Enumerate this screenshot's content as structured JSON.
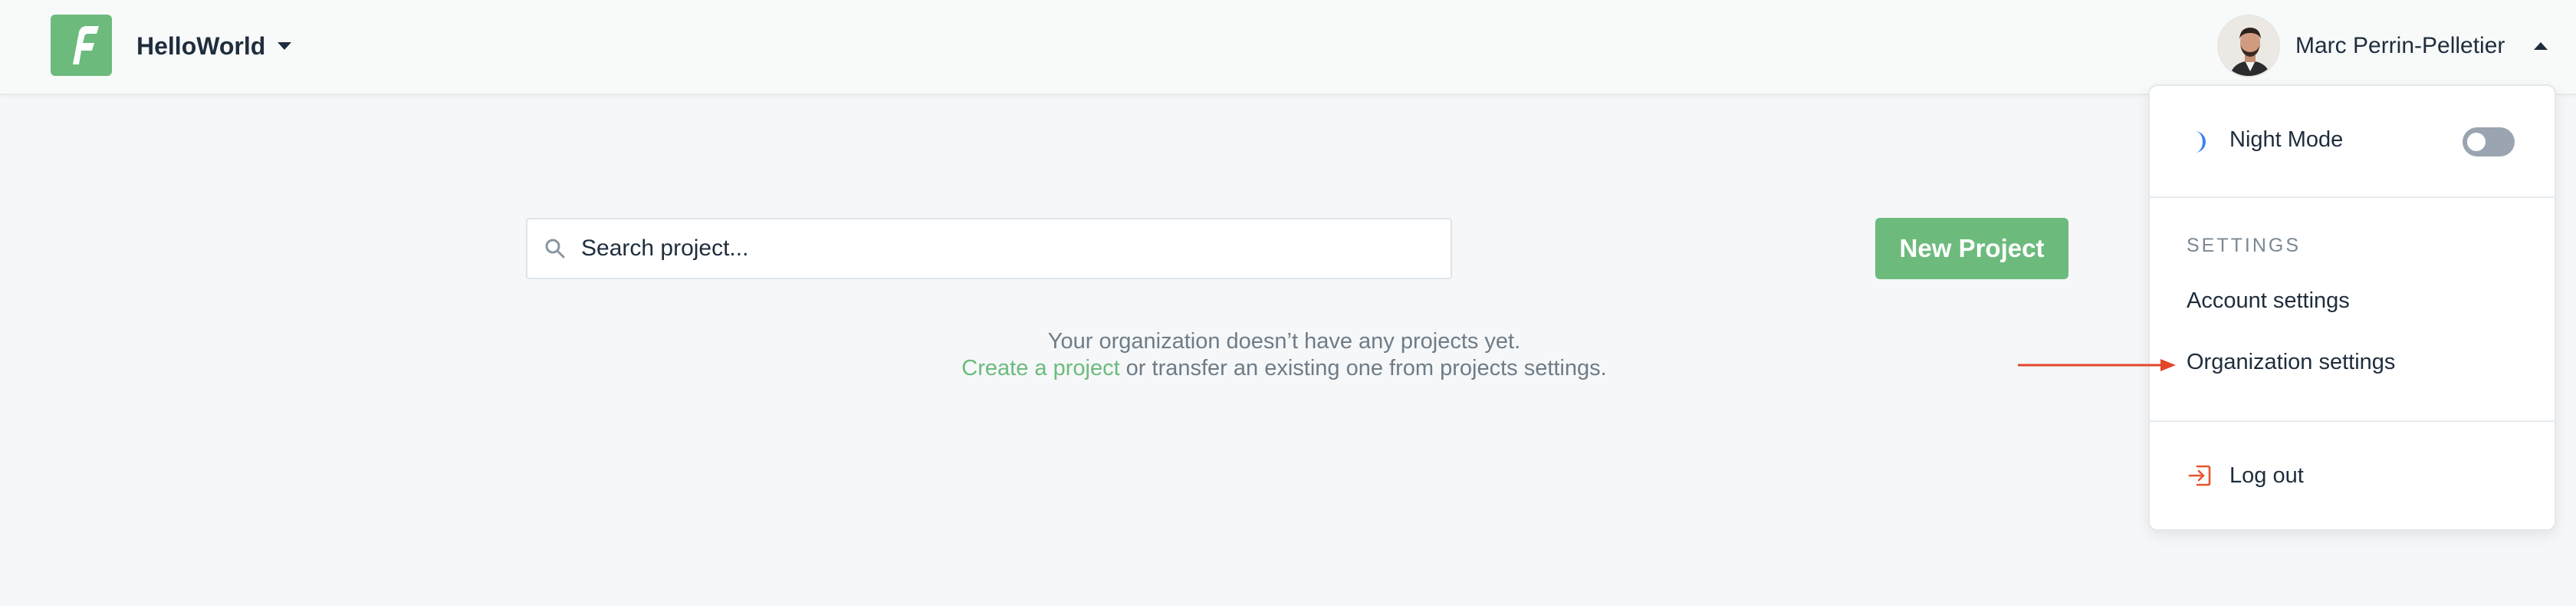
{
  "header": {
    "org_name": "HelloWorld",
    "user_name": "Marc Perrin-Pelletier",
    "logo_letter": "F"
  },
  "main": {
    "search": {
      "placeholder": "Search project..."
    },
    "new_project_label": "New Project",
    "empty_line1": "Your organization doesn’t have any projects yet.",
    "empty_link": "Create a project",
    "empty_line2_rest": " or transfer an existing one from projects settings."
  },
  "dropdown": {
    "night_mode_label": "Night Mode",
    "night_mode_on": false,
    "settings_heading": "SETTINGS",
    "account_settings": "Account settings",
    "organization_settings": "Organization settings",
    "logout_label": "Log out"
  },
  "colors": {
    "brand": "#6cbb7d",
    "logout_accent": "#e4572e",
    "annotation_arrow": "#e4462b",
    "moon": "#3b82f6"
  },
  "icons": [
    "search-icon",
    "moon-icon",
    "logout-icon",
    "chevron-down-icon",
    "chevron-up-icon"
  ]
}
